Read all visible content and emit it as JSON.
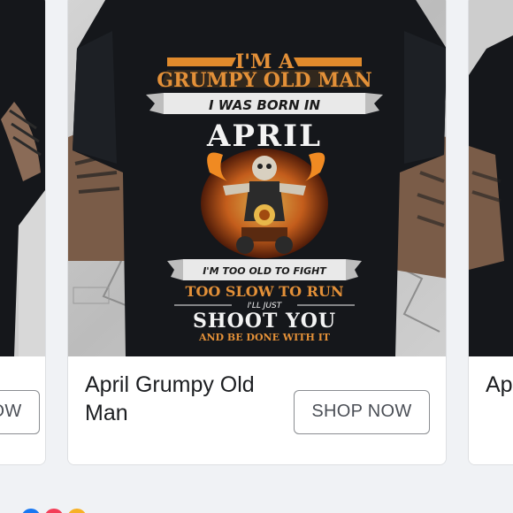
{
  "carousel": {
    "cards": [
      {
        "id": "left",
        "title": "",
        "button_label": "SHOP NOW"
      },
      {
        "id": "main",
        "title": "April Grumpy Old Man",
        "button_label": "SHOP NOW",
        "shirt_print": {
          "line1": "I'M A",
          "line2": "GRUMPY OLD MAN",
          "line3": "I WAS BORN IN",
          "line4": "APRIL",
          "line5": "I'M TOO OLD TO FIGHT",
          "line6": "TOO SLOW TO RUN",
          "line7": "I'LL JUST",
          "line8": "SHOOT YOU",
          "line9": "AND BE DONE WITH IT"
        }
      },
      {
        "id": "right",
        "title": "Ap",
        "button_label": ""
      }
    ]
  },
  "stats": {
    "reactions": "",
    "comments": "",
    "shares": ""
  },
  "colors": {
    "page_bg": "#f0f2f5",
    "card_bg": "#ffffff",
    "shirt": "#15171b",
    "print_orange": "#e08a2c",
    "print_white": "#f3f3f3",
    "button_border": "#8a8d91",
    "text": "#1c1e21"
  }
}
